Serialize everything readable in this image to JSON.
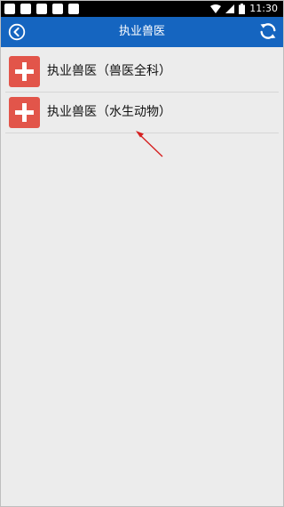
{
  "status_bar": {
    "time": "11:30",
    "notification_icons": [
      "square-icon",
      "square-icon",
      "square-icon",
      "square-icon",
      "square-icon"
    ],
    "indicators": [
      "wifi-icon",
      "signal-icon",
      "battery-icon"
    ]
  },
  "header": {
    "title": "执业兽医",
    "back_icon": "back-circle-icon",
    "refresh_icon": "refresh-icon",
    "background": "#1565c0"
  },
  "list": {
    "items": [
      {
        "label": "执业兽医（兽医全科）",
        "icon": "add-icon"
      },
      {
        "label": "执业兽医（水生动物）",
        "icon": "add-icon"
      }
    ],
    "icon_color": "#e2554a"
  },
  "annotation": {
    "arrow_color": "#d62020"
  }
}
